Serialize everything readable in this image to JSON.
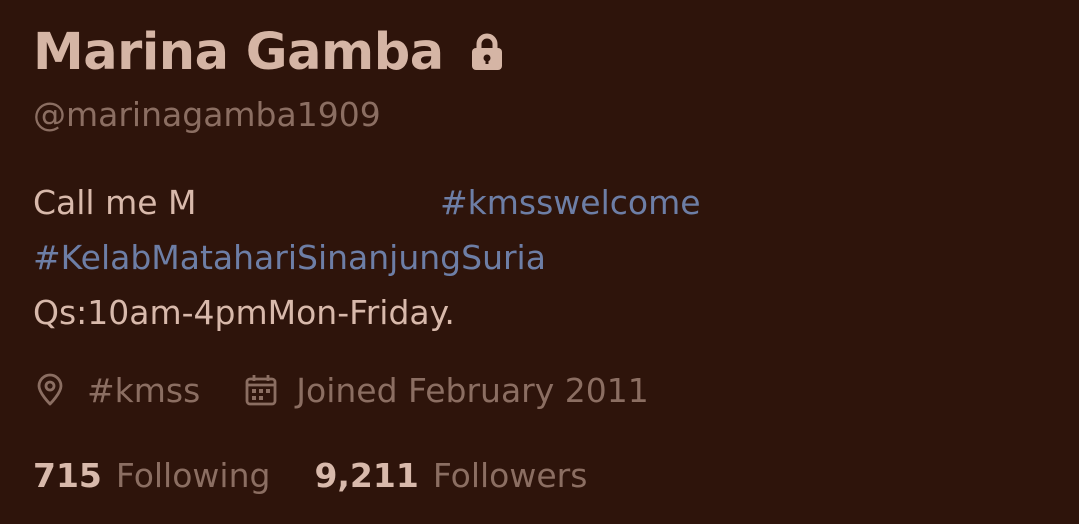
{
  "profile": {
    "display_name": "Marina Gamba",
    "handle": "@marinagamba1909",
    "protected_icon": "lock-icon",
    "bio": {
      "line1_text": "Call me M",
      "line1_hashtag": "#kmsswelcome",
      "line2_hashtag": "#KelabMatahariSinanjungSuria",
      "line3_text": "Qs:10am-4pmMon-Friday."
    },
    "meta": {
      "location_icon": "location-pin-icon",
      "location": "#kmss",
      "joined_icon": "calendar-icon",
      "joined": "Joined February 2011"
    },
    "stats": {
      "following_count": "715",
      "following_label": "Following",
      "followers_count": "9,211",
      "followers_label": "Followers"
    }
  },
  "colors": {
    "background": "#2e140b",
    "primary_text": "#d8b9ab",
    "secondary_text": "#8b6e62",
    "link": "#6d7ea6"
  }
}
